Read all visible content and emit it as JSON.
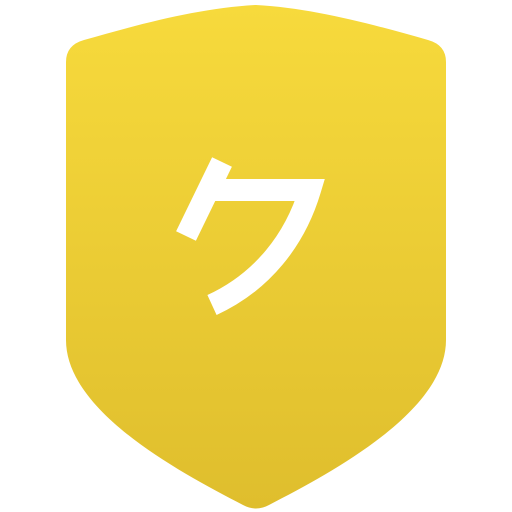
{
  "badge": {
    "glyph": "ク",
    "icon": "shield-icon",
    "colors": {
      "top": "#F7DA3C",
      "bottom": "#DFBE2D",
      "glyph": "#FFFFFF",
      "background": "#FFFFFF"
    }
  }
}
